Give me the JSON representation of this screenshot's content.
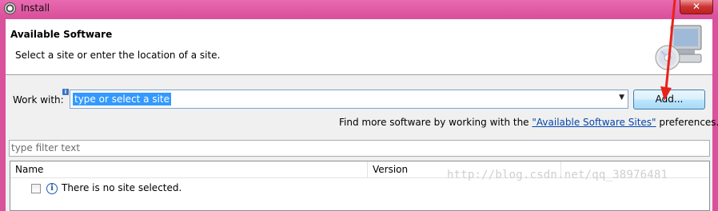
{
  "window": {
    "title": "Install",
    "close_label": "✕"
  },
  "header": {
    "title": "Available Software",
    "description": "Select a site or enter the location of a site."
  },
  "work_with": {
    "label": "Work with:",
    "info_badge": "i",
    "value": "type or select a site",
    "add_button": "Add..."
  },
  "find_more": {
    "prefix": "Find more software by working with the ",
    "link": "\"Available Software Sites\"",
    "suffix": " preferences."
  },
  "filter": {
    "placeholder": "type filter text"
  },
  "table": {
    "columns": [
      "Name",
      "Version"
    ],
    "rows": [
      {
        "text": "There is no site selected.",
        "checked": false,
        "icon": "info-icon"
      }
    ]
  },
  "watermark": "http://blog.csdn.net/qq_38976481",
  "colors": {
    "title_bar": "#d9509a",
    "selection": "#3399ff",
    "annotation_arrow": "#e8221b"
  }
}
